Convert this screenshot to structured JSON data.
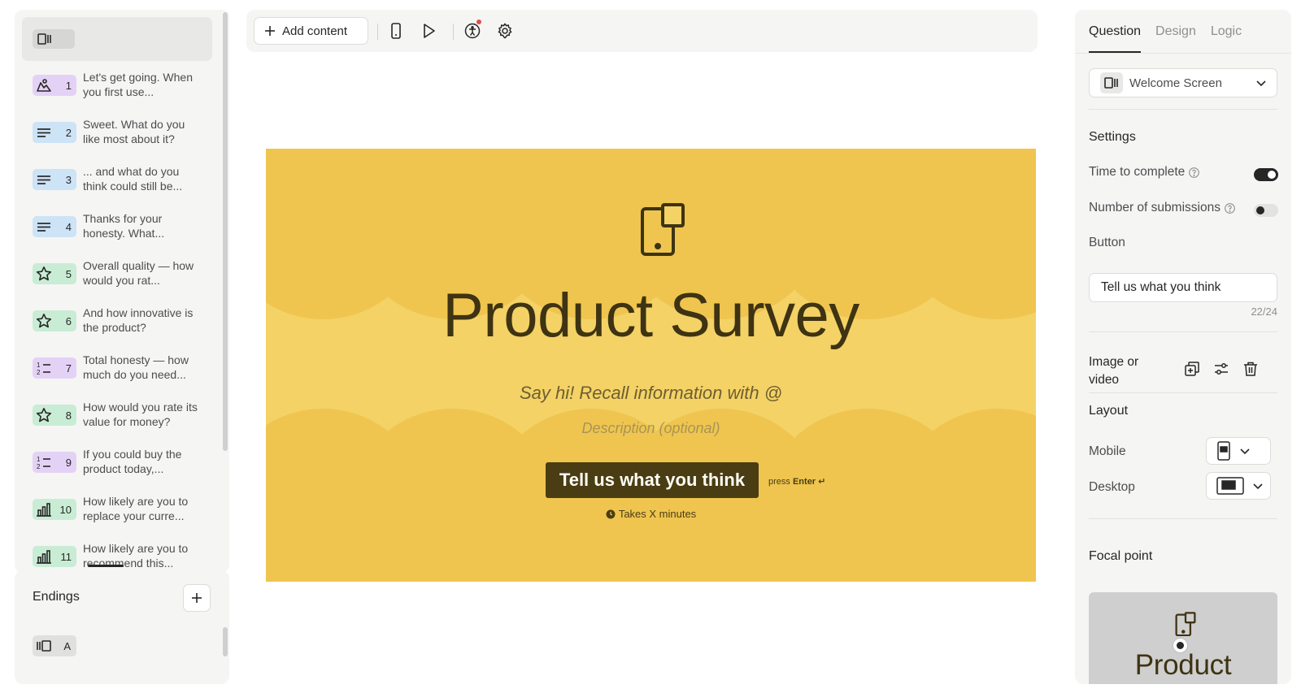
{
  "toolbar": {
    "add_content_label": "Add content"
  },
  "questions": [
    {
      "num": "1",
      "label": "Let's get going. When you first use...",
      "type": "purple",
      "icon": "person-icon"
    },
    {
      "num": "2",
      "label": "Sweet. What do you like most about it?",
      "type": "blue",
      "icon": "text-lines-icon"
    },
    {
      "num": "3",
      "label": "... and what do you think could still be...",
      "type": "blue",
      "icon": "text-lines-icon"
    },
    {
      "num": "4",
      "label": "Thanks for your honesty. What...",
      "type": "blue",
      "icon": "text-lines-icon"
    },
    {
      "num": "5",
      "label": "Overall quality — how would you rat...",
      "type": "green",
      "icon": "star-icon"
    },
    {
      "num": "6",
      "label": "And how innovative is the product?",
      "type": "green",
      "icon": "star-icon"
    },
    {
      "num": "7",
      "label": "Total honesty — how much do you need...",
      "type": "purple",
      "icon": "ranking-icon"
    },
    {
      "num": "8",
      "label": "How would you rate its value for money?",
      "type": "green",
      "icon": "star-icon"
    },
    {
      "num": "9",
      "label": "If you could buy the product today,...",
      "type": "purple",
      "icon": "ranking-icon"
    },
    {
      "num": "10",
      "label": "How likely are you to replace your curre...",
      "type": "green",
      "icon": "bar-chart-icon"
    },
    {
      "num": "11",
      "label": "How likely are you to recommend this...",
      "type": "green",
      "icon": "bar-chart-icon"
    }
  ],
  "endings": {
    "title": "Endings",
    "items": [
      {
        "letter": "A"
      }
    ]
  },
  "canvas": {
    "title": "Product Survey",
    "subtitle": "Say hi! Recall information with @",
    "description": "Description (optional)",
    "button_label": "Tell us what you think",
    "press_hint_prefix": "press",
    "press_hint_key": "Enter ↵",
    "takes_time": "Takes X minutes",
    "bg_color": "#f4d266",
    "accent_color": "#4a3d13"
  },
  "right_panel": {
    "tabs": [
      "Question",
      "Design",
      "Logic"
    ],
    "active_tab": "Question",
    "type_select": "Welcome Screen",
    "settings_title": "Settings",
    "time_to_complete": {
      "label": "Time to complete",
      "on": true
    },
    "num_submissions": {
      "label": "Number of submissions",
      "on": false
    },
    "button_section": "Button",
    "button_value": "Tell us what you think",
    "char_count": "22/24",
    "image_or_video": "Image or video",
    "layout_title": "Layout",
    "mobile_label": "Mobile",
    "desktop_label": "Desktop",
    "focal_title": "Focal point",
    "focal_preview_title": "Product Survey"
  }
}
